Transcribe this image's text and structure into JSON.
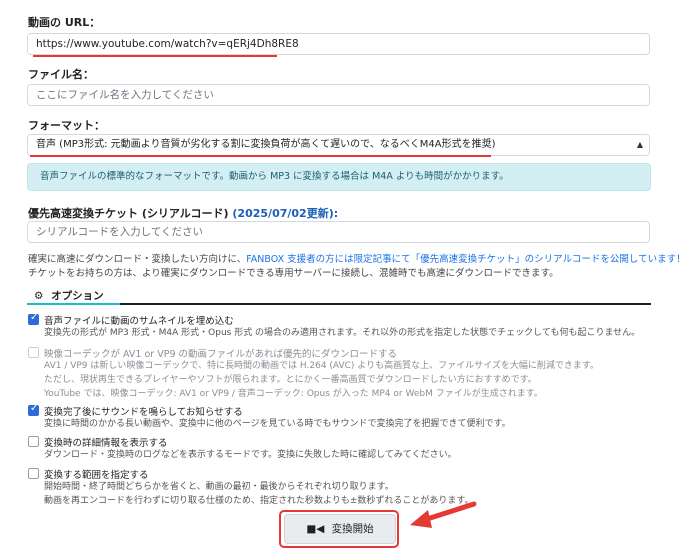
{
  "url": {
    "label": "動画の URL：",
    "value": "https://www.youtube.com/watch?v=qERj4Dh8RE8"
  },
  "filename": {
    "label": "ファイル名：",
    "placeholder": "ここにファイル名を入力してください"
  },
  "format": {
    "label": "フォーマット：",
    "selected": "音声 (MP3形式: 元動画より音質が劣化する割に変換負荷が高くて遅いので、なるべくM4A形式を推奨)",
    "info": "音声ファイルの標準的なフォーマットです。動画から MP3 に変換する場合は M4A よりも時間がかかります。"
  },
  "ticket": {
    "label": "優先高速変換チケット (シリアルコード)",
    "label_date": "(2025/07/02更新):",
    "placeholder": "シリアルコードを入力してください",
    "note1_pre": "確実に高速にダウンロード・変換したい方向けに、",
    "note1_link": "FANBOX 支援者の方には限定記事にて「優先高速変換チケット」のシリアルコードを公開しています！",
    "note2": "チケットをお持ちの方は、より確実にダウンロードできる専用サーバーに接続し、混雑時でも高速にダウンロードできます。"
  },
  "options": {
    "title": "オプション",
    "icon": "gear-icon",
    "items": [
      {
        "title": "音声ファイルに動画のサムネイルを埋め込む",
        "desc": [
          "変換先の形式が MP3 形式・M4A 形式・Opus 形式 の場合のみ適用されます。それ以外の形式を指定した状態でチェックしても何も起こりません。"
        ],
        "checked": true,
        "disabled": false
      },
      {
        "title": "映像コーデックが AV1 or VP9 の動画ファイルがあれば優先的にダウンロードする",
        "desc": [
          "AV1 / VP9 は新しい映像コーデックで、特に長時間の動画では H.264 (AVC) よりも高画質な上、ファイルサイズを大幅に削減できます。",
          "ただし、現状再生できるプレイヤーやソフトが限られます。とにかく一番高画質でダウンロードしたい方におすすめです。",
          "YouTube では、映像コーデック: AV1 or VP9 / 音声コーデック: Opus が入った MP4 or WebM ファイルが生成されます。"
        ],
        "checked": false,
        "disabled": true
      },
      {
        "title": "変換完了後にサウンドを鳴らしてお知らせする",
        "desc": [
          "変換に時間のかかる長い動画や、変換中に他のページを見ている時でもサウンドで変換完了を把握できて便利です。"
        ],
        "checked": true,
        "disabled": false
      },
      {
        "title": "変換時の詳細情報を表示する",
        "desc": [
          "ダウンロード・変換時のログなどを表示するモードです。変換に失敗した時に確認してみてください。"
        ],
        "checked": false,
        "disabled": false
      },
      {
        "title": "変換する範囲を指定する",
        "desc": [
          "開始時間・終了時間どちらかを省くと、動画の最初・最後からそれぞれ切り取ります。",
          "動画を再エンコードを行わずに切り取る仕様のため、指定された秒数よりも±数秒ずれることがあります。"
        ],
        "checked": false,
        "disabled": false
      }
    ]
  },
  "start_button": {
    "label": "変換開始",
    "icon": "video-camera-icon"
  },
  "colors": {
    "annotation_red": "#e53935",
    "accent_teal": "#17c0c9",
    "checkbox_blue": "#2f6bd8"
  }
}
